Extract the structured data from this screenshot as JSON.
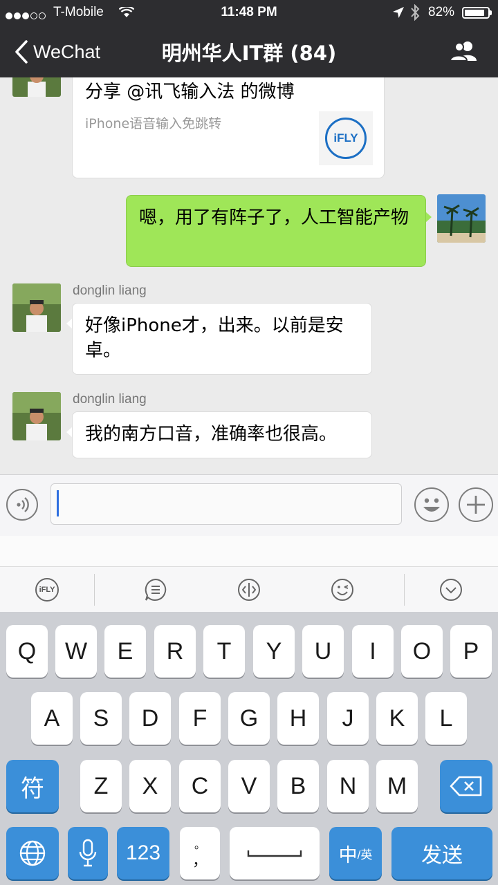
{
  "status": {
    "carrier": "T-Mobile",
    "time": "11:48 PM",
    "battery": "82%"
  },
  "nav": {
    "back_label": "WeChat",
    "title": "明州华人IT群 (84)"
  },
  "messages": {
    "share_title": "分享 @讯飞输入法 的微博",
    "share_desc": "iPhone语音输入免跳转",
    "share_logo": "iFLY",
    "me_text": "嗯，用了有阵子了，人工智能产物",
    "msg2_sender": "donglin liang",
    "msg2_text": "好像iPhone才，出来。以前是安卓。",
    "msg3_sender": "donglin liang",
    "msg3_text": "我的南方口音，准确率也很高。"
  },
  "ime": {
    "logo": "iFLY"
  },
  "keyboard": {
    "row1": [
      "Q",
      "W",
      "E",
      "R",
      "T",
      "Y",
      "U",
      "I",
      "O",
      "P"
    ],
    "row2": [
      "A",
      "S",
      "D",
      "F",
      "G",
      "H",
      "J",
      "K",
      "L"
    ],
    "row3": [
      "Z",
      "X",
      "C",
      "V",
      "B",
      "N",
      "M"
    ],
    "symbols": "符",
    "numbers": "123",
    "punct_top": "。",
    "punct_bottom": "，",
    "lang_main": "中",
    "lang_sub": "/英",
    "send": "发送"
  },
  "colors": {
    "nav": "#2d2d30",
    "my_bubble": "#9fe658",
    "key_blue": "#3b8fd9"
  }
}
